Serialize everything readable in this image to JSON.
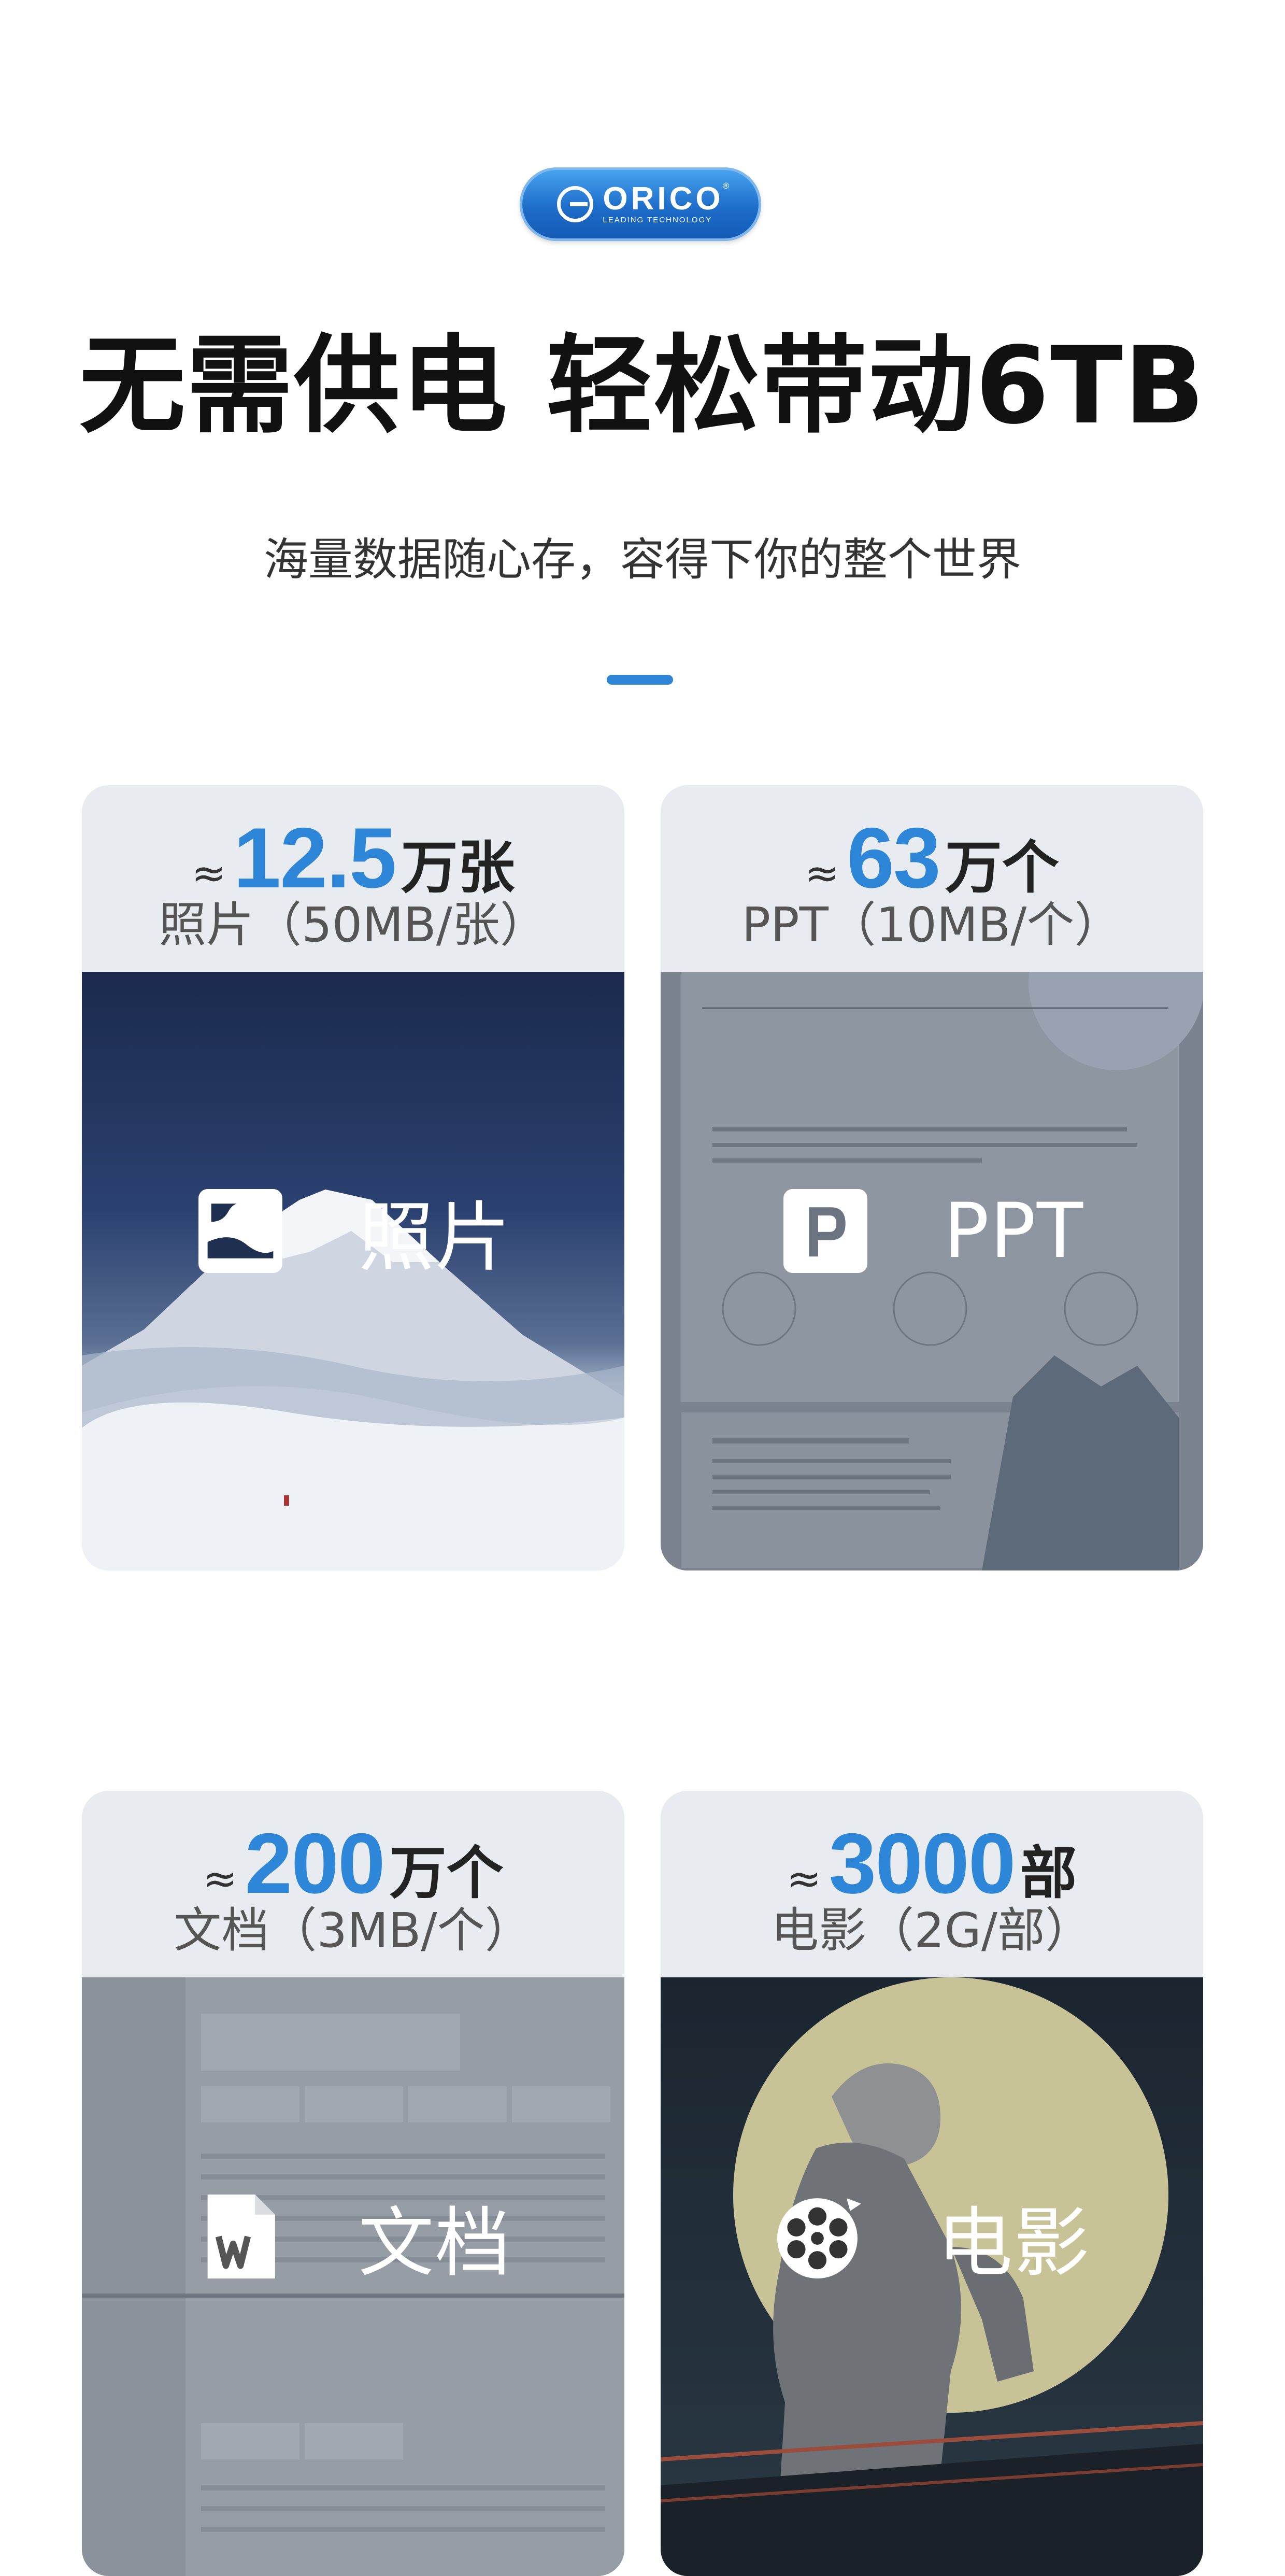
{
  "logo": {
    "brand": "ORICO",
    "tagline": "LEADING TECHNOLOGY",
    "registered": "®"
  },
  "headline": "无需供电 轻松带动6TB",
  "subheadline": "海量数据随心存，容得下你的整个世界",
  "colors": {
    "accent": "#2e86d8",
    "card_bg": "#e8ecf0",
    "title": "#111111"
  },
  "cards": [
    {
      "approx": "≈",
      "number": "12.5",
      "unit": "万张",
      "desc": "照片（50MB/张）",
      "icon": "photo-icon",
      "label": "照片"
    },
    {
      "approx": "≈",
      "number": "63",
      "unit": "万个",
      "desc": "PPT（10MB/个）",
      "icon": "ppt-icon",
      "label": "PPT"
    },
    {
      "approx": "≈",
      "number": "200",
      "unit": "万个",
      "desc": "文档（3MB/个）",
      "icon": "document-icon",
      "label": "文档"
    },
    {
      "approx": "≈",
      "number": "3000",
      "unit": "部",
      "desc": "电影（2G/部）",
      "icon": "film-reel-icon",
      "label": "电影"
    }
  ]
}
